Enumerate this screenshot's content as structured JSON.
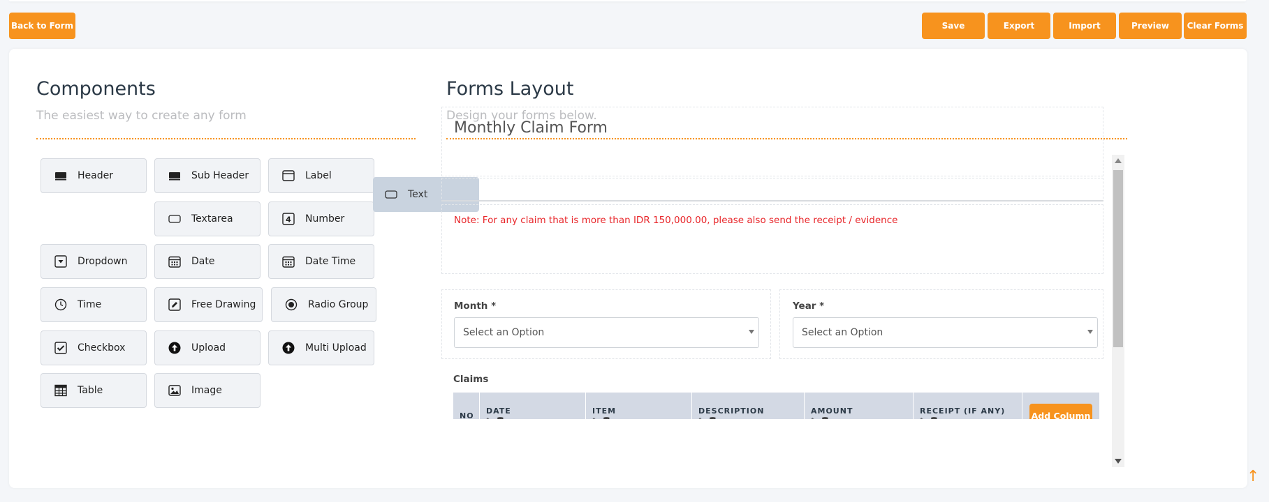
{
  "toolbar": {
    "back_label": "Back to Form",
    "save_label": "Save",
    "export_label": "Export",
    "import_label": "Import",
    "preview_label": "Preview",
    "clear_label": "Clear Forms"
  },
  "components_panel": {
    "title": "Components",
    "subtitle": "The easiest way to create any form",
    "items": [
      {
        "label": "Header",
        "icon": "header-icon"
      },
      {
        "label": "Sub Header",
        "icon": "sub-header-icon"
      },
      {
        "label": "Label",
        "icon": "label-icon"
      },
      {
        "label": "Textarea",
        "icon": "textarea-icon"
      },
      {
        "label": "Number",
        "icon": "number-icon"
      },
      {
        "label": "Dropdown",
        "icon": "dropdown-icon"
      },
      {
        "label": "Date",
        "icon": "calendar-icon"
      },
      {
        "label": "Date Time",
        "icon": "calendar-icon"
      },
      {
        "label": "Time",
        "icon": "clock-icon"
      },
      {
        "label": "Free Drawing",
        "icon": "pencil-icon"
      },
      {
        "label": "Radio Group",
        "icon": "radio-icon"
      },
      {
        "label": "Checkbox",
        "icon": "checkbox-icon"
      },
      {
        "label": "Upload",
        "icon": "upload-icon"
      },
      {
        "label": "Multi Upload",
        "icon": "upload-icon"
      },
      {
        "label": "Table",
        "icon": "table-icon"
      },
      {
        "label": "Image",
        "icon": "image-icon"
      }
    ],
    "dragging": {
      "label": "Text",
      "icon": "text-input-icon"
    }
  },
  "layout_panel": {
    "title": "Forms Layout",
    "subtitle": "Design your forms below.",
    "form_title": "Monthly Claim Form",
    "note": "Note: For any claim that is more than IDR 150,000.00, please also send the receipt / evidence",
    "fields": {
      "month": {
        "label": "Month *",
        "placeholder": "Select an Option"
      },
      "year": {
        "label": "Year *",
        "placeholder": "Select an Option"
      }
    },
    "claims": {
      "label": "Claims",
      "columns": [
        "NO",
        "DATE",
        "ITEM",
        "DESCRIPTION",
        "AMOUNT",
        "RECEIPT (IF ANY)"
      ],
      "column_tools": "✎ 🗑",
      "add_column_label": "Add Column"
    }
  },
  "colors": {
    "accent": "#f7931e",
    "note_red": "#e8262a",
    "table_header_bg": "#d3d9e4"
  },
  "back_to_top_icon": "↑"
}
